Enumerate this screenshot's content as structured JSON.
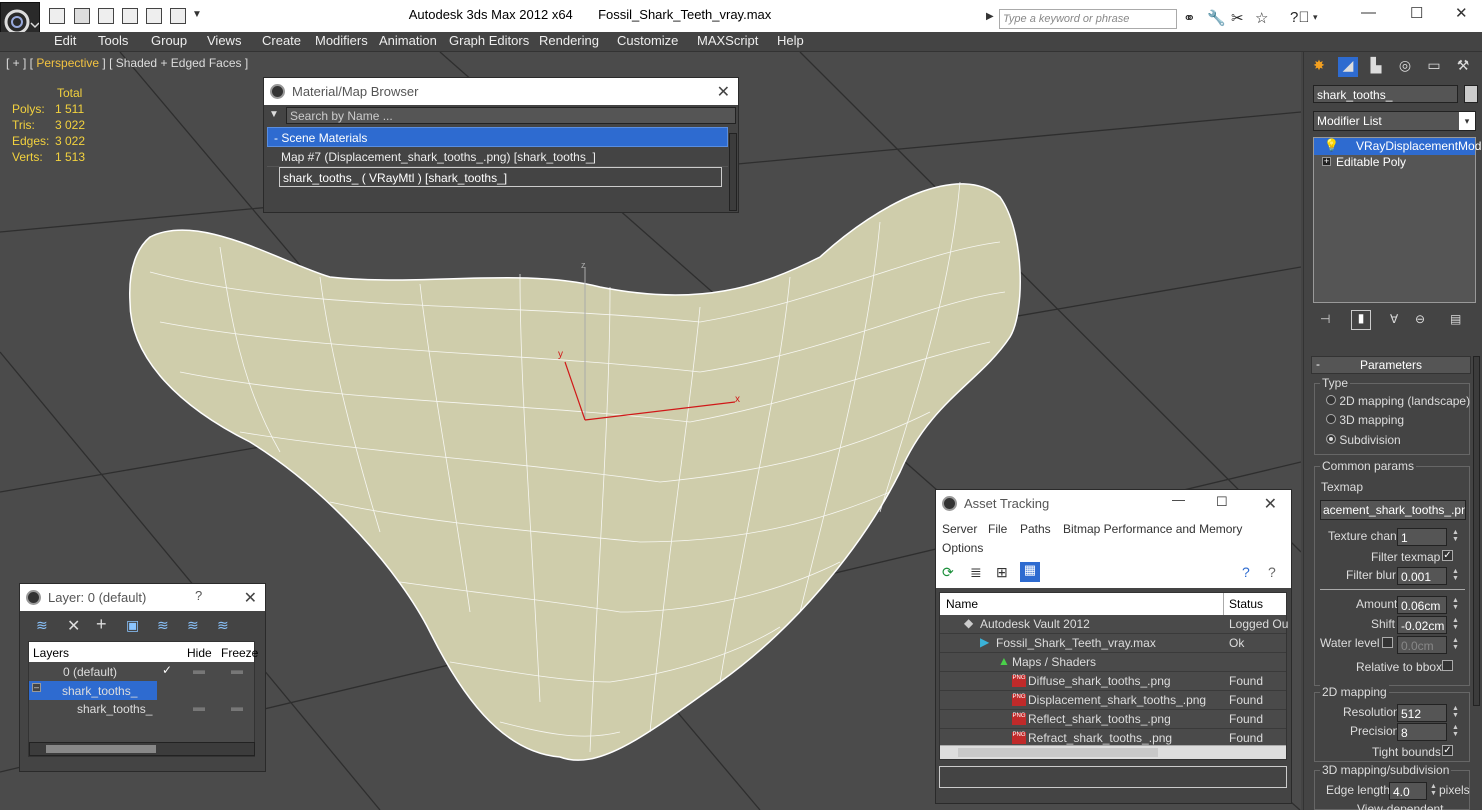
{
  "app": {
    "title": "Autodesk 3ds Max  2012 x64",
    "file": "Fossil_Shark_Teeth_vray.max",
    "search_placeholder": "Type a keyword or phrase"
  },
  "menu": [
    "Edit",
    "Tools",
    "Group",
    "Views",
    "Create",
    "Modifiers",
    "Animation",
    "Graph Editors",
    "Rendering",
    "Customize",
    "MAXScript",
    "Help"
  ],
  "viewport": {
    "label_prefix": "[ + ] [ ",
    "label_view": "Perspective",
    "label_suffix": " ] [ Shaded + Edged Faces ]",
    "stats": {
      "header": "Total",
      "rows": [
        {
          "label": "Polys:",
          "value": "1 511"
        },
        {
          "label": "Tris:",
          "value": "3 022"
        },
        {
          "label": "Edges:",
          "value": "3 022"
        },
        {
          "label": "Verts:",
          "value": "1 513"
        }
      ]
    },
    "axis": {
      "x": "x",
      "y": "y",
      "z": "z"
    }
  },
  "material_browser": {
    "title": "Material/Map Browser",
    "search_placeholder": "Search by Name ...",
    "group": "- Scene Materials",
    "items": [
      "Map #7 (Displacement_shark_tooths_.png) [shark_tooths_]",
      "shark_tooths_  ( VRayMtl ) [shark_tooths_]"
    ]
  },
  "layer_window": {
    "title": "Layer: 0 (default)",
    "help": "?",
    "columns": [
      "Layers",
      "Hide",
      "Freeze"
    ],
    "rows": [
      {
        "name": "0 (default)",
        "check": "✓"
      },
      {
        "name": "shark_tooths_"
      },
      {
        "name": "shark_tooths_"
      }
    ]
  },
  "asset_tracking": {
    "title": "Asset Tracking",
    "menu": [
      "Server",
      "File",
      "Paths",
      "Bitmap Performance and Memory",
      "Options"
    ],
    "columns": [
      "Name",
      "Status"
    ],
    "rows": [
      {
        "name": "Autodesk Vault 2012",
        "status": "Logged Ou"
      },
      {
        "name": "Fossil_Shark_Teeth_vray.max",
        "status": "Ok"
      },
      {
        "name": "Maps / Shaders",
        "status": ""
      },
      {
        "name": "Diffuse_shark_tooths_.png",
        "status": "Found"
      },
      {
        "name": "Displacement_shark_tooths_.png",
        "status": "Found"
      },
      {
        "name": "Reflect_shark_tooths_.png",
        "status": "Found"
      },
      {
        "name": "Refract_shark_tooths_.png",
        "status": "Found"
      }
    ]
  },
  "command_panel": {
    "object_name": "shark_tooths_",
    "modifier_list": "Modifier List",
    "stack": [
      "VRayDisplacementMod",
      "Editable Poly"
    ],
    "rollout": "Parameters",
    "type_group": "Type",
    "type_options": [
      {
        "label": "2D mapping (landscape)",
        "selected": false
      },
      {
        "label": "3D mapping",
        "selected": false
      },
      {
        "label": "Subdivision",
        "selected": true
      }
    ],
    "common_group": "Common params",
    "texmap_label": "Texmap",
    "texmap_value": "acement_shark_tooths_.png)",
    "texture_chan_label": "Texture chan",
    "texture_chan_value": "1",
    "filter_texmap_label": "Filter texmap",
    "filter_blur_label": "Filter blur",
    "filter_blur_value": "0.001",
    "amount_label": "Amount",
    "amount_value": "0.06cm",
    "shift_label": "Shift",
    "shift_value": "-0.02cm",
    "water_level_label": "Water level",
    "water_level_value": "0.0cm",
    "relative_label": "Relative to bbox",
    "mapping2d_group": "2D mapping",
    "resolution_label": "Resolution",
    "resolution_value": "512",
    "precision_label": "Precision",
    "precision_value": "8",
    "tight_bounds_label": "Tight bounds",
    "mapping3d_group": "3D mapping/subdivision",
    "edge_length_label": "Edge length",
    "edge_length_value": "4.0",
    "pixels_label": "pixels",
    "view_dependent_label": "View-dependent"
  }
}
